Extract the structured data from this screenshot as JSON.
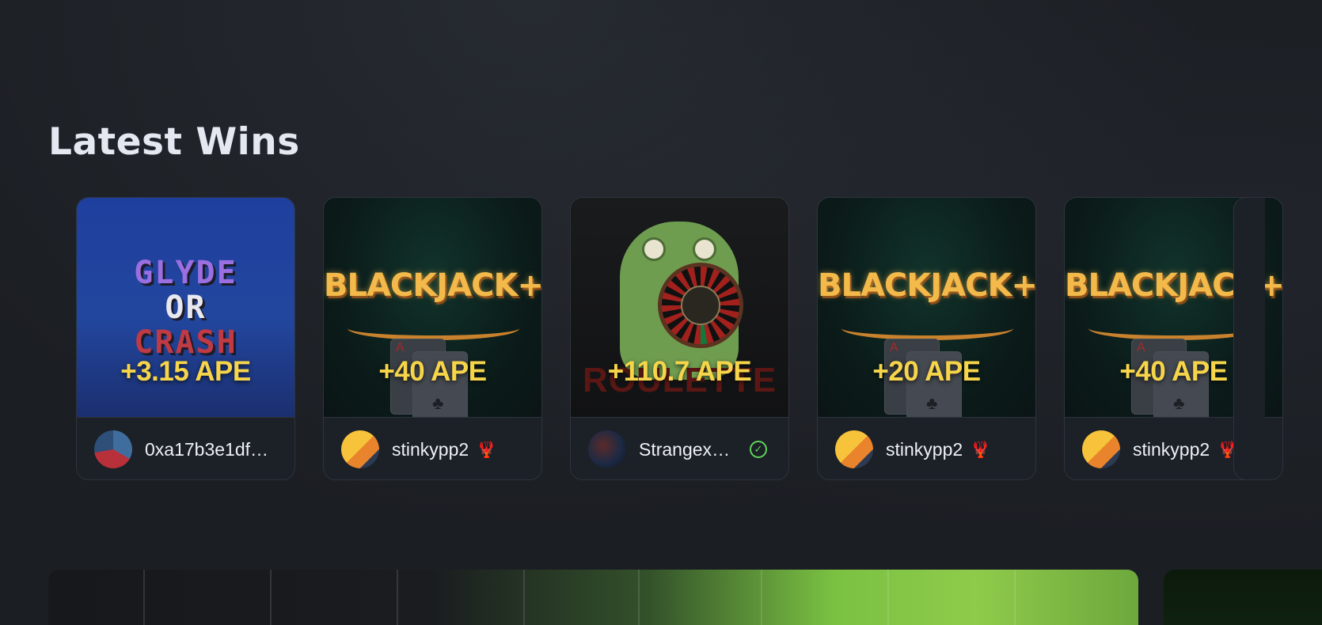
{
  "section": {
    "title": "Latest Wins"
  },
  "wins": [
    {
      "game": "Glyde or Crash",
      "game_lines": [
        "GLYDE",
        "OR",
        "CRASH"
      ],
      "amount": "+3.15 APE",
      "user": "0xa17b3e1df…",
      "badge": ""
    },
    {
      "game": "Blackjack+",
      "game_title": "BLACKJACK+",
      "amount": "+40 APE",
      "user": "stinkypp2",
      "badge": "🦞"
    },
    {
      "game": "Roulette",
      "game_title": "ROULETTE",
      "amount": "+110.7 APE",
      "user": "StrangexS…",
      "badge": "verified"
    },
    {
      "game": "Blackjack+",
      "game_title": "BLACKJACK+",
      "amount": "+20 APE",
      "user": "stinkypp2",
      "badge": "🦞"
    },
    {
      "game": "Blackjack+",
      "game_title": "BLACKJACK+",
      "amount": "+40 APE",
      "user": "stinkypp2",
      "badge": "🦞"
    }
  ],
  "colors": {
    "amount": "#f6d54a",
    "background": "#1b1e23",
    "verified": "#5fd45a"
  },
  "icons": {
    "verified": "check-circle-icon"
  }
}
